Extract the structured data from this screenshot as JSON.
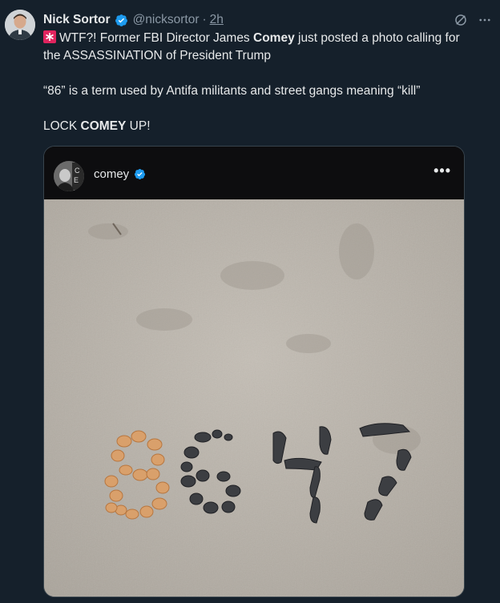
{
  "author": {
    "name": "Nick Sortor",
    "handle": "@nicksortor",
    "separator": "·",
    "time": "2h"
  },
  "tweet": {
    "line1_prefix": "WTF?! Former FBI Director James ",
    "line1_bold": "Comey",
    "line1_suffix": " just posted a photo calling for",
    "line2": "the ASSASSINATION of President Trump",
    "para2": "“86” is a term used by Antifa militants and street gangs meaning “kill”",
    "para3_prefix": "LOCK ",
    "para3_bold": "COMEY",
    "para3_suffix": " UP!"
  },
  "embed": {
    "username": "comey",
    "more": "•••",
    "photo_text": "8647"
  },
  "colors": {
    "background": "#15202b",
    "verified": "#1d9bf0",
    "muted": "#8b98a5",
    "siren": "#e0245e",
    "sand": "#b7b1a8"
  },
  "icons": {
    "verified": "verified-badge-icon",
    "grok": "grok-icon",
    "more": "more-options-icon",
    "siren": "rotating-light-icon"
  }
}
